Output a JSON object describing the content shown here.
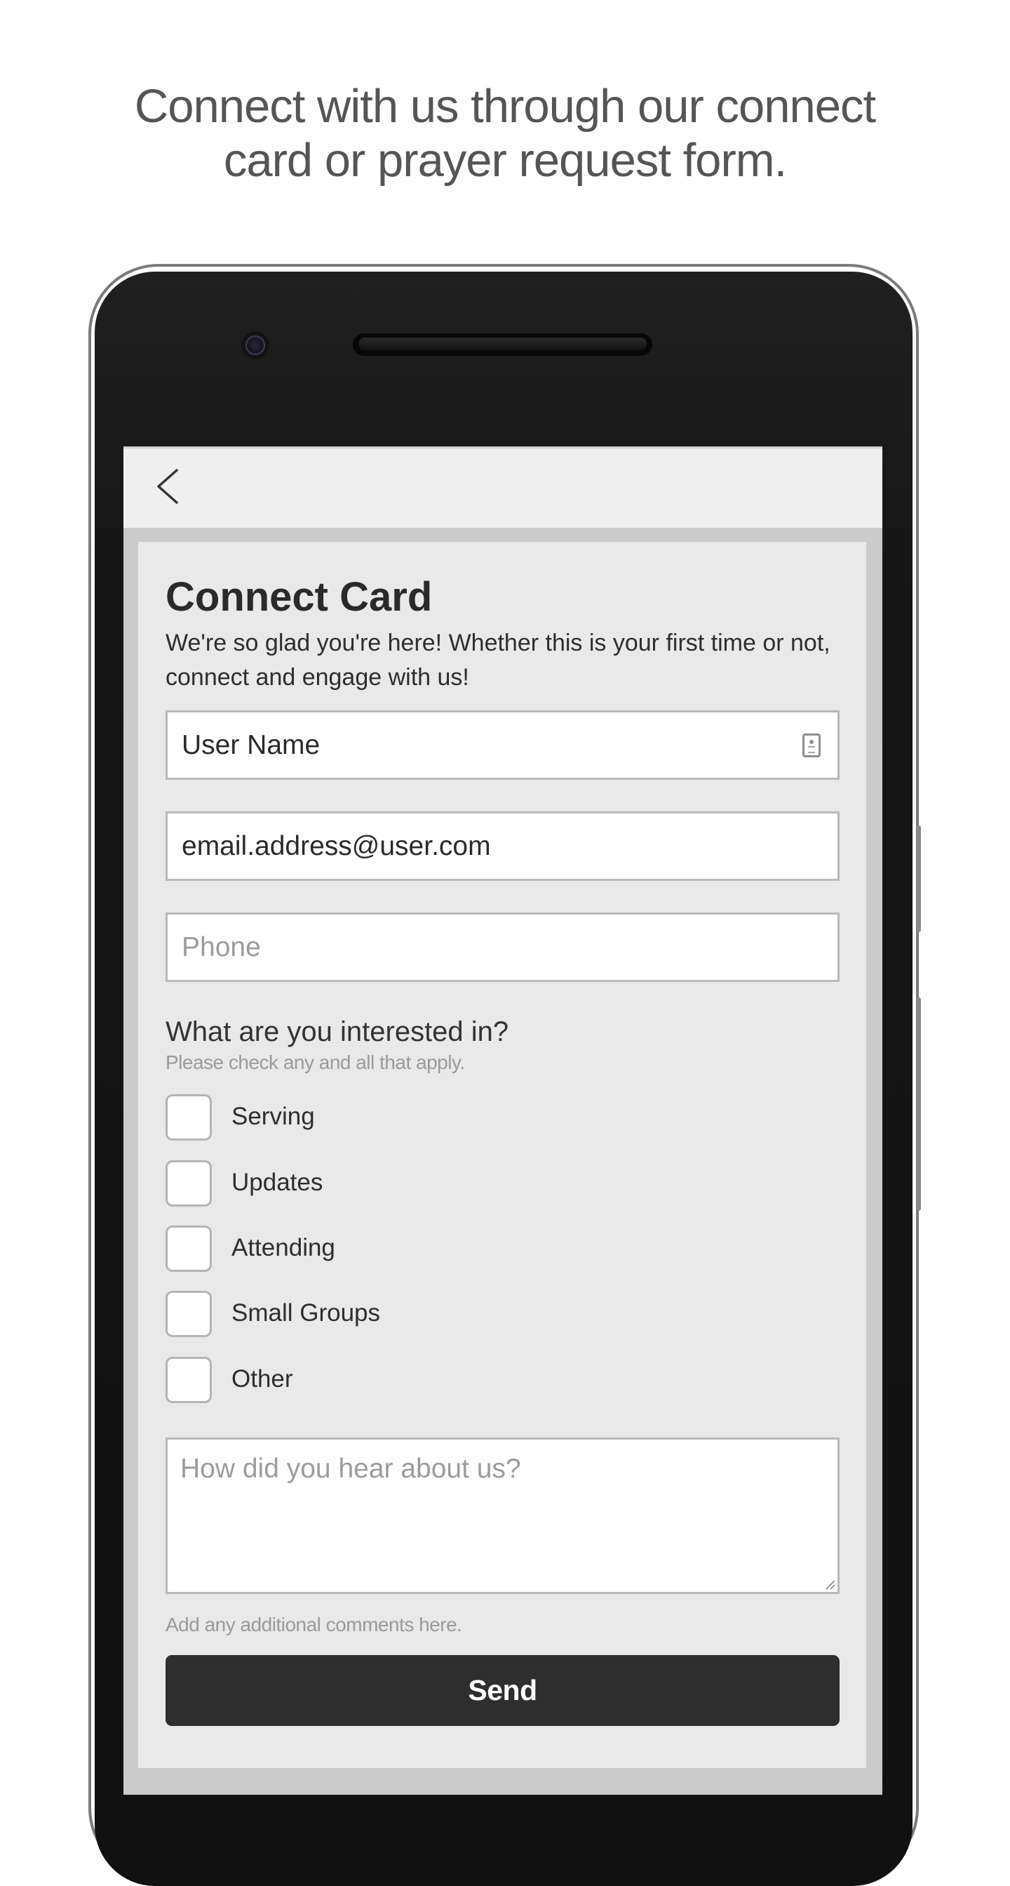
{
  "headline": {
    "line1": "Connect with us through our connect",
    "line2": "card or prayer request form."
  },
  "header": {
    "back_icon": "chevron-left-icon"
  },
  "form": {
    "title": "Connect Card",
    "description": "We're so glad you're here! Whether this is your first time or not, connect and engage with us!",
    "fields": {
      "name": {
        "value": "User Name",
        "placeholder": "",
        "icon": "contact-card-icon"
      },
      "email": {
        "value": "email.address@user.com",
        "placeholder": ""
      },
      "phone": {
        "value": "",
        "placeholder": "Phone"
      }
    },
    "interests": {
      "question": "What are you interested in?",
      "hint": "Please check any and all that apply.",
      "options": [
        {
          "label": "Serving",
          "checked": false
        },
        {
          "label": "Updates",
          "checked": false
        },
        {
          "label": "Attending",
          "checked": false
        },
        {
          "label": "Small Groups",
          "checked": false
        },
        {
          "label": "Other",
          "checked": false
        }
      ]
    },
    "comments": {
      "placeholder": "How did you hear about us?",
      "hint": "Add any additional comments here."
    },
    "send_label": "Send"
  },
  "colors": {
    "button_bg": "#2e2e2e",
    "card_bg": "#e9e9e9",
    "frame_bg": "#cbcbcb",
    "header_bg": "#efefef"
  }
}
